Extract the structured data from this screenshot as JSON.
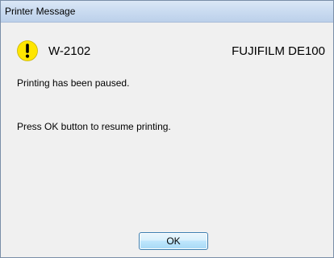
{
  "window": {
    "title": "Printer Message"
  },
  "message": {
    "icon": "warning-exclamation-icon",
    "code": "W-2102",
    "model": "FUJIFILM DE100",
    "line1": "Printing has been paused.",
    "line2": "Press OK button to resume printing."
  },
  "buttons": {
    "ok_label": "OK"
  },
  "colors": {
    "warning_fill": "#ffe600",
    "warning_mark": "#000000",
    "button_border": "#3c7fb1",
    "titlebar": "#c8daf0"
  }
}
